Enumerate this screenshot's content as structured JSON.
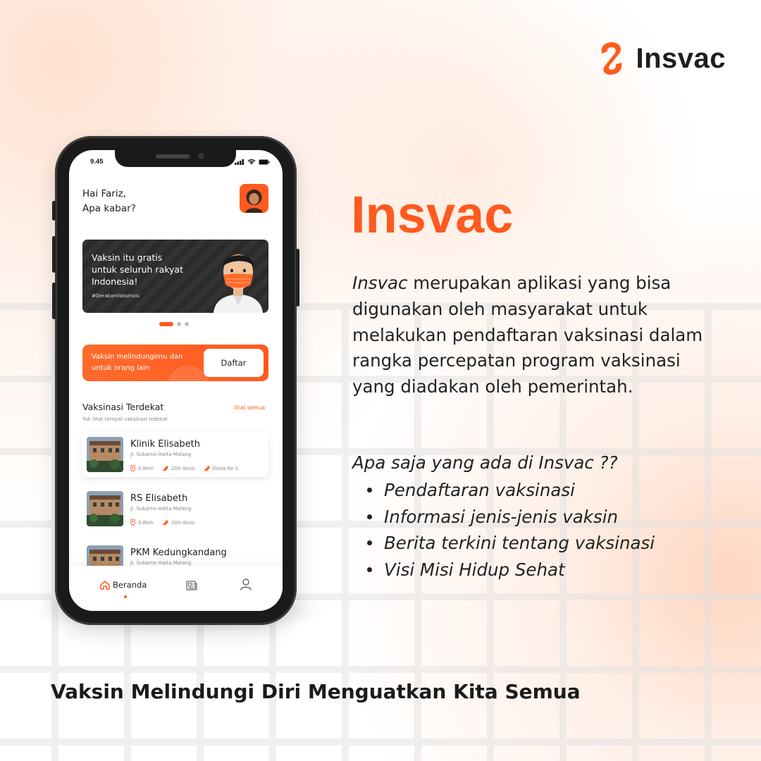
{
  "brand": {
    "name": "Insvac",
    "accent": "#ff5a1f"
  },
  "hero": {
    "title": "Insvac",
    "desc_em": "Insvac",
    "desc_rest": " merupakan aplikasi yang bisa digunakan oleh masyarakat untuk melakukan pendaftaran vaksinasi dalam rangka percepatan program vaksinasi yang diadakan oleh pemerintah.",
    "features_title": "Apa saja yang ada di Insvac ??",
    "features": [
      "Pendaftaran vaksinasi",
      "Informasi jenis-jenis vaksin",
      "Berita terkini tentang vaksinasi",
      "Visi Misi Hidup Sehat"
    ]
  },
  "tagline": "Vaksin Melindungi Diri Menguatkan Kita Semua",
  "phone": {
    "status_time": "9.45",
    "greeting_line1": "Hai Fariz,",
    "greeting_line2": "Apa kabar?",
    "banner": {
      "text": "Vaksin itu gratis untuk seluruh rakyat Indonesia!",
      "hashtag": "#GerakanVaksinasi",
      "slides": 3,
      "active_slide": 1
    },
    "cta": {
      "text": "Vaksin melindungimu dan untuk orang lain",
      "button": "Daftar"
    },
    "section": {
      "title": "Vaksinasi Terdekat",
      "link": "lihat semua",
      "subtitle": "Yuk lihat tempat vaksinasi tedekat"
    },
    "places": [
      {
        "name": "Klinik Elisabeth",
        "address": "Jl. Sukarno Hatta Malang",
        "distance": "0.8km",
        "doses": "200 dosis",
        "dose_no": "Dosis Ke-1"
      },
      {
        "name": "RS Elisabeth",
        "address": "Jl. Sukarno Hatta Malang",
        "distance": "0.8km",
        "doses": "200 dosis",
        "dose_no": ""
      },
      {
        "name": "PKM Kedungkandang",
        "address": "Jl. Sukarno Hatta Malang",
        "distance": "",
        "doses": "",
        "dose_no": ""
      }
    ],
    "nav": {
      "home": "Beranda"
    }
  }
}
